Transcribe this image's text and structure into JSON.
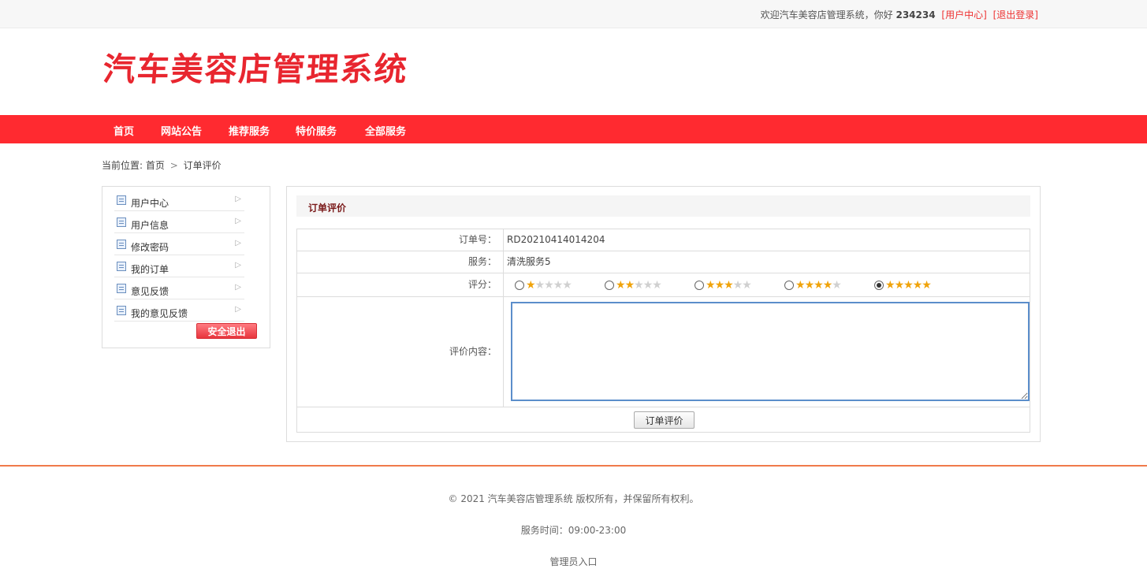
{
  "topbar": {
    "welcome": "欢迎汽车美容店管理系统，你好",
    "username": "234234",
    "user_center": "[用户中心]",
    "logout": "[退出登录]"
  },
  "logo": "汽车美容店管理系统",
  "nav": [
    {
      "label": "首页"
    },
    {
      "label": "网站公告"
    },
    {
      "label": "推荐服务"
    },
    {
      "label": "特价服务"
    },
    {
      "label": "全部服务"
    }
  ],
  "breadcrumb": {
    "prefix": "当前位置:",
    "home": "首页",
    "separator": ">",
    "current": "订单评价"
  },
  "sidebar": {
    "items": [
      {
        "label": "用户中心"
      },
      {
        "label": "用户信息"
      },
      {
        "label": "修改密码"
      },
      {
        "label": "我的订单"
      },
      {
        "label": "意见反馈"
      },
      {
        "label": "我的意见反馈"
      }
    ],
    "logout_button": "安全退出"
  },
  "panel": {
    "title": "订单评价",
    "order_no_label": "订单号：",
    "order_no": "RD20210414014204",
    "service_label": "服务：",
    "service": "清洗服务5",
    "rating_label": "评分：",
    "ratings": [
      {
        "stars": 1,
        "selected": false
      },
      {
        "stars": 2,
        "selected": false
      },
      {
        "stars": 3,
        "selected": false
      },
      {
        "stars": 4,
        "selected": false
      },
      {
        "stars": 5,
        "selected": true
      }
    ],
    "content_label": "评价内容：",
    "content_value": "",
    "submit_label": "订单评价"
  },
  "footer": {
    "copyright": "© 2021 汽车美容店管理系统 版权所有，并保留所有权利。",
    "hours": "服务时间：09:00-23:00",
    "admin_entry": "管理员入口"
  },
  "colors": {
    "brand_red": "#ff2a30",
    "logo_red": "#e8262f",
    "star": "#f0a30a",
    "footer_line": "#f07a4a"
  }
}
